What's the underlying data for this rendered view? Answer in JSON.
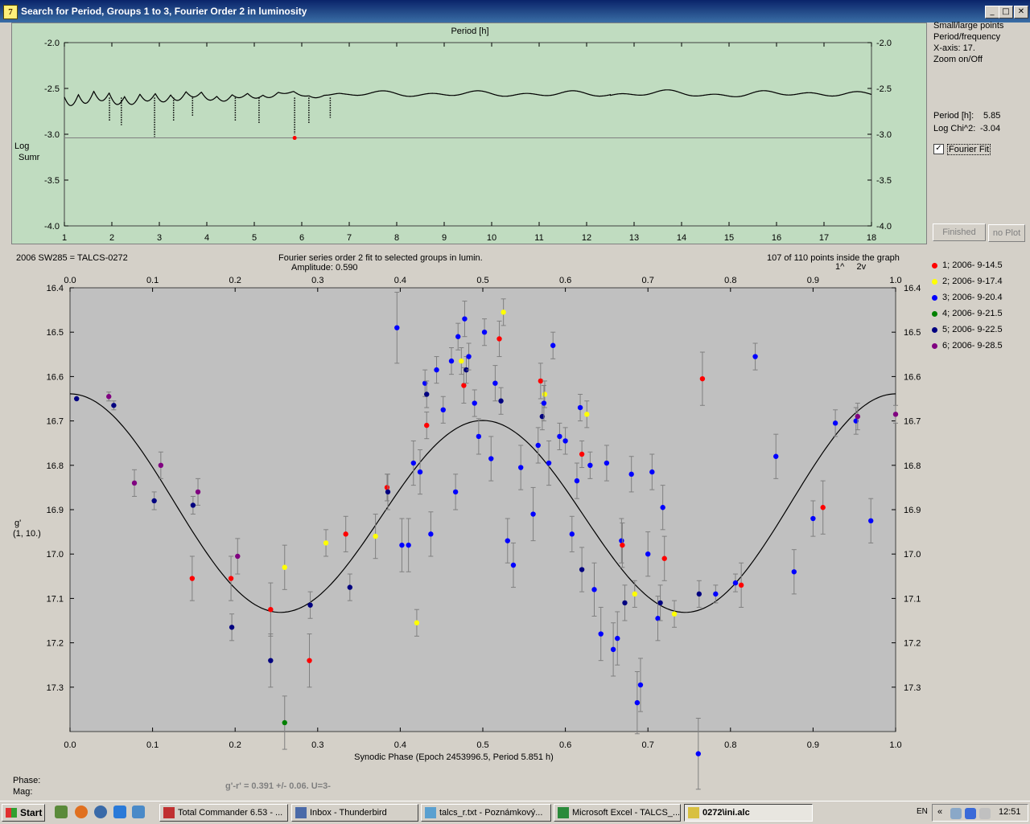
{
  "window": {
    "title": "Search for Period, Groups 1 to 3, Fourier Order 2 in luminosity",
    "minimize": "_",
    "maximize": "□",
    "close": "✕",
    "app_icon_text": "7"
  },
  "periodogram": {
    "top_label": "Period [h]",
    "ylabel_line1": "Log",
    "ylabel_line2": "Sumr",
    "y_ticks": [
      "-2.0",
      "-2.5",
      "-3.0",
      "-3.5",
      "-4.0"
    ],
    "x_ticks": [
      "1",
      "2",
      "3",
      "4",
      "5",
      "6",
      "7",
      "8",
      "9",
      "10",
      "11",
      "12",
      "13",
      "14",
      "15",
      "16",
      "17",
      "18"
    ],
    "best_log_chi2": -3.04,
    "best_period": 5.85
  },
  "side": {
    "small_large": "Small/large points",
    "period_freq": "Period/frequency",
    "x_axis": "X-axis: 17.",
    "zoom": "Zoom on/Off",
    "period_label": "Period [h]:",
    "period_value": "5.85",
    "logchi_label": "Log Chi^2:",
    "logchi_value": "-3.04",
    "fourier_fit": "Fourier Fit",
    "fourier_checked": "✓",
    "finished": "Finished",
    "noplot": "no Plot"
  },
  "phase_header": {
    "object": "2006 SW285 = TALCS-0272",
    "series": "Fourier series order 2 fit to selected groups in lumin.",
    "amplitude": "Amplitude: 0.590",
    "points": "107 of 110 points inside the graph",
    "marks": "1^     2v"
  },
  "legend": [
    {
      "label": "1; 2006- 9-14.5",
      "color": "#ff0000"
    },
    {
      "label": "2; 2006- 9-17.4",
      "color": "#ffff00"
    },
    {
      "label": "3; 2006- 9-20.4",
      "color": "#0000ff"
    },
    {
      "label": "4; 2006- 9-21.5",
      "color": "#008000"
    },
    {
      "label": "5; 2006- 9-22.5",
      "color": "#000080"
    },
    {
      "label": "6; 2006- 9-28.5",
      "color": "#800080"
    }
  ],
  "chart_data": {
    "type": "scatter",
    "xlabel": "Synodic Phase (Epoch 2453996.5, Period 5.851 h)",
    "ylabel": "g'",
    "ylabel2": "(1, 10.)",
    "xlim": [
      0.0,
      1.0
    ],
    "ylim": [
      16.4,
      17.4
    ],
    "y_inverted": true,
    "x_ticks": [
      "0.0",
      "0.1",
      "0.2",
      "0.3",
      "0.4",
      "0.5",
      "0.6",
      "0.7",
      "0.8",
      "0.9",
      "1.0"
    ],
    "y_ticks": [
      "16.4",
      "16.5",
      "16.6",
      "16.7",
      "16.8",
      "16.9",
      "17.0",
      "17.1",
      "17.2",
      "17.3"
    ],
    "fit": {
      "mean": 16.9,
      "a1": 0.21,
      "phase1": 0.0,
      "a2": 0.06
    },
    "points": [
      {
        "x": 0.008,
        "y": 16.65,
        "g": 5,
        "e": 0
      },
      {
        "x": 0.047,
        "y": 16.645,
        "g": 6,
        "e": 0.01
      },
      {
        "x": 0.053,
        "y": 16.665,
        "g": 5,
        "e": 0.01
      },
      {
        "x": 0.078,
        "y": 16.84,
        "g": 6,
        "e": 0.03
      },
      {
        "x": 0.102,
        "y": 16.88,
        "g": 5,
        "e": 0.02
      },
      {
        "x": 0.11,
        "y": 16.8,
        "g": 6,
        "e": 0.03
      },
      {
        "x": 0.148,
        "y": 17.055,
        "g": 1,
        "e": 0.05
      },
      {
        "x": 0.149,
        "y": 16.89,
        "g": 5,
        "e": 0.02
      },
      {
        "x": 0.155,
        "y": 16.86,
        "g": 6,
        "e": 0.03
      },
      {
        "x": 0.195,
        "y": 17.055,
        "g": 1,
        "e": 0.05
      },
      {
        "x": 0.196,
        "y": 17.165,
        "g": 5,
        "e": 0.03
      },
      {
        "x": 0.203,
        "y": 17.005,
        "g": 6,
        "e": 0.04
      },
      {
        "x": 0.243,
        "y": 17.125,
        "g": 1,
        "e": 0.06
      },
      {
        "x": 0.243,
        "y": 17.24,
        "g": 5,
        "e": 0.06
      },
      {
        "x": 0.26,
        "y": 17.03,
        "g": 2,
        "e": 0.05
      },
      {
        "x": 0.26,
        "y": 17.38,
        "g": 4,
        "e": 0.06
      },
      {
        "x": 0.29,
        "y": 17.24,
        "g": 1,
        "e": 0.06
      },
      {
        "x": 0.291,
        "y": 17.115,
        "g": 5,
        "e": 0.03
      },
      {
        "x": 0.31,
        "y": 16.975,
        "g": 2,
        "e": 0.03
      },
      {
        "x": 0.334,
        "y": 16.955,
        "g": 1,
        "e": 0.04
      },
      {
        "x": 0.339,
        "y": 17.075,
        "g": 5,
        "e": 0.03
      },
      {
        "x": 0.37,
        "y": 16.96,
        "g": 2,
        "e": 0.05
      },
      {
        "x": 0.384,
        "y": 16.85,
        "g": 1,
        "e": 0.03
      },
      {
        "x": 0.385,
        "y": 16.86,
        "g": 5,
        "e": 0.04
      },
      {
        "x": 0.396,
        "y": 16.49,
        "g": 3,
        "e": 0.08
      },
      {
        "x": 0.402,
        "y": 16.98,
        "g": 3,
        "e": 0.06
      },
      {
        "x": 0.41,
        "y": 16.98,
        "g": 3,
        "e": 0.06
      },
      {
        "x": 0.42,
        "y": 17.155,
        "g": 2,
        "e": 0.03
      },
      {
        "x": 0.416,
        "y": 16.795,
        "g": 3,
        "e": 0.05
      },
      {
        "x": 0.424,
        "y": 16.815,
        "g": 3,
        "e": 0.05
      },
      {
        "x": 0.43,
        "y": 16.615,
        "g": 3,
        "e": 0.03
      },
      {
        "x": 0.432,
        "y": 16.64,
        "g": 5,
        "e": 0.03
      },
      {
        "x": 0.432,
        "y": 16.71,
        "g": 1,
        "e": 0.03
      },
      {
        "x": 0.437,
        "y": 16.955,
        "g": 3,
        "e": 0.05
      },
      {
        "x": 0.444,
        "y": 16.585,
        "g": 3,
        "e": 0.03
      },
      {
        "x": 0.452,
        "y": 16.675,
        "g": 3,
        "e": 0.03
      },
      {
        "x": 0.462,
        "y": 16.565,
        "g": 3,
        "e": 0.03
      },
      {
        "x": 0.467,
        "y": 16.86,
        "g": 3,
        "e": 0.04
      },
      {
        "x": 0.47,
        "y": 16.51,
        "g": 3,
        "e": 0.03
      },
      {
        "x": 0.474,
        "y": 16.565,
        "g": 2,
        "e": 0.03
      },
      {
        "x": 0.477,
        "y": 16.62,
        "g": 1,
        "e": 0.04
      },
      {
        "x": 0.478,
        "y": 16.47,
        "g": 3,
        "e": 0.04
      },
      {
        "x": 0.48,
        "y": 16.585,
        "g": 5,
        "e": 0.03
      },
      {
        "x": 0.483,
        "y": 16.555,
        "g": 3,
        "e": 0.03
      },
      {
        "x": 0.49,
        "y": 16.66,
        "g": 3,
        "e": 0.03
      },
      {
        "x": 0.495,
        "y": 16.735,
        "g": 3,
        "e": 0.04
      },
      {
        "x": 0.502,
        "y": 16.5,
        "g": 3,
        "e": 0.03
      },
      {
        "x": 0.51,
        "y": 16.785,
        "g": 3,
        "e": 0.05
      },
      {
        "x": 0.515,
        "y": 16.615,
        "g": 3,
        "e": 0.04
      },
      {
        "x": 0.52,
        "y": 16.515,
        "g": 1,
        "e": 0.04
      },
      {
        "x": 0.522,
        "y": 16.655,
        "g": 5,
        "e": 0.03
      },
      {
        "x": 0.525,
        "y": 16.455,
        "g": 2,
        "e": 0.03
      },
      {
        "x": 0.53,
        "y": 16.97,
        "g": 3,
        "e": 0.05
      },
      {
        "x": 0.537,
        "y": 17.025,
        "g": 3,
        "e": 0.05
      },
      {
        "x": 0.546,
        "y": 16.805,
        "g": 3,
        "e": 0.05
      },
      {
        "x": 0.561,
        "y": 16.91,
        "g": 3,
        "e": 0.06
      },
      {
        "x": 0.567,
        "y": 16.755,
        "g": 3,
        "e": 0.04
      },
      {
        "x": 0.57,
        "y": 16.61,
        "g": 1,
        "e": 0.04
      },
      {
        "x": 0.572,
        "y": 16.69,
        "g": 5,
        "e": 0.03
      },
      {
        "x": 0.575,
        "y": 16.64,
        "g": 2,
        "e": 0.03
      },
      {
        "x": 0.574,
        "y": 16.66,
        "g": 3,
        "e": 0.04
      },
      {
        "x": 0.58,
        "y": 16.795,
        "g": 3,
        "e": 0.05
      },
      {
        "x": 0.585,
        "y": 16.53,
        "g": 3,
        "e": 0.03
      },
      {
        "x": 0.593,
        "y": 16.735,
        "g": 3,
        "e": 0.03
      },
      {
        "x": 0.6,
        "y": 16.745,
        "g": 3,
        "e": 0.03
      },
      {
        "x": 0.608,
        "y": 16.955,
        "g": 3,
        "e": 0.04
      },
      {
        "x": 0.614,
        "y": 16.835,
        "g": 3,
        "e": 0.04
      },
      {
        "x": 0.618,
        "y": 16.67,
        "g": 3,
        "e": 0.03
      },
      {
        "x": 0.62,
        "y": 17.035,
        "g": 5,
        "e": 0.05
      },
      {
        "x": 0.62,
        "y": 16.775,
        "g": 1,
        "e": 0.03
      },
      {
        "x": 0.626,
        "y": 16.685,
        "g": 2,
        "e": 0.03
      },
      {
        "x": 0.63,
        "y": 16.8,
        "g": 3,
        "e": 0.03
      },
      {
        "x": 0.635,
        "y": 17.08,
        "g": 3,
        "e": 0.06
      },
      {
        "x": 0.643,
        "y": 17.18,
        "g": 3,
        "e": 0.06
      },
      {
        "x": 0.65,
        "y": 16.795,
        "g": 3,
        "e": 0.04
      },
      {
        "x": 0.658,
        "y": 17.215,
        "g": 3,
        "e": 0.06
      },
      {
        "x": 0.663,
        "y": 17.19,
        "g": 3,
        "e": 0.06
      },
      {
        "x": 0.668,
        "y": 16.97,
        "g": 3,
        "e": 0.05
      },
      {
        "x": 0.669,
        "y": 16.98,
        "g": 1,
        "e": 0.05
      },
      {
        "x": 0.672,
        "y": 17.11,
        "g": 5,
        "e": 0.04
      },
      {
        "x": 0.68,
        "y": 16.82,
        "g": 3,
        "e": 0.04
      },
      {
        "x": 0.684,
        "y": 17.09,
        "g": 2,
        "e": 0.03
      },
      {
        "x": 0.687,
        "y": 17.335,
        "g": 3,
        "e": 0.07
      },
      {
        "x": 0.691,
        "y": 17.295,
        "g": 3,
        "e": 0.06
      },
      {
        "x": 0.7,
        "y": 17.0,
        "g": 3,
        "e": 0.05
      },
      {
        "x": 0.705,
        "y": 16.815,
        "g": 3,
        "e": 0.04
      },
      {
        "x": 0.712,
        "y": 17.145,
        "g": 3,
        "e": 0.05
      },
      {
        "x": 0.715,
        "y": 17.11,
        "g": 5,
        "e": 0.04
      },
      {
        "x": 0.718,
        "y": 16.895,
        "g": 3,
        "e": 0.05
      },
      {
        "x": 0.72,
        "y": 17.01,
        "g": 1,
        "e": 0.05
      },
      {
        "x": 0.732,
        "y": 17.135,
        "g": 2,
        "e": 0.03
      },
      {
        "x": 0.761,
        "y": 17.45,
        "g": 3,
        "e": 0.08
      },
      {
        "x": 0.762,
        "y": 17.09,
        "g": 5,
        "e": 0.03
      },
      {
        "x": 0.766,
        "y": 16.605,
        "g": 1,
        "e": 0.06
      },
      {
        "x": 0.782,
        "y": 17.09,
        "g": 3,
        "e": 0.02
      },
      {
        "x": 0.806,
        "y": 17.065,
        "g": 3,
        "e": 0.02
      },
      {
        "x": 0.813,
        "y": 17.07,
        "g": 1,
        "e": 0.05
      },
      {
        "x": 0.83,
        "y": 16.555,
        "g": 3,
        "e": 0.03
      },
      {
        "x": 0.855,
        "y": 16.78,
        "g": 3,
        "e": 0.05
      },
      {
        "x": 0.877,
        "y": 17.04,
        "g": 3,
        "e": 0.05
      },
      {
        "x": 0.9,
        "y": 16.92,
        "g": 3,
        "e": 0.04
      },
      {
        "x": 0.912,
        "y": 16.895,
        "g": 1,
        "e": 0.06
      },
      {
        "x": 0.927,
        "y": 16.705,
        "g": 3,
        "e": 0.03
      },
      {
        "x": 0.952,
        "y": 16.7,
        "g": 3,
        "e": 0.03
      },
      {
        "x": 0.954,
        "y": 16.69,
        "g": 6,
        "e": 0.03
      },
      {
        "x": 0.97,
        "y": 16.925,
        "g": 3,
        "e": 0.05
      },
      {
        "x": 1.0,
        "y": 16.685,
        "g": 6,
        "e": 0.02
      }
    ]
  },
  "bottom": {
    "phase_label": "Phase:",
    "mag_label": "Mag:",
    "color_index": "g'-r' = 0.391 +/- 0.06.  U=3-"
  },
  "taskbar": {
    "start": "Start",
    "items": [
      {
        "label": "Total Commander 6.53 - ...",
        "icon": "#c03030"
      },
      {
        "label": "Inbox - Thunderbird",
        "icon": "#4a6aa8"
      },
      {
        "label": "talcs_r.txt - Poznámkový...",
        "icon": "#5aa0d0"
      },
      {
        "label": "Microsoft Excel - TALCS_...",
        "icon": "#2a8a3a"
      },
      {
        "label": "0272\\ini.alc",
        "icon": "#d8c040"
      }
    ],
    "lang": "EN",
    "clock": "12:51"
  }
}
